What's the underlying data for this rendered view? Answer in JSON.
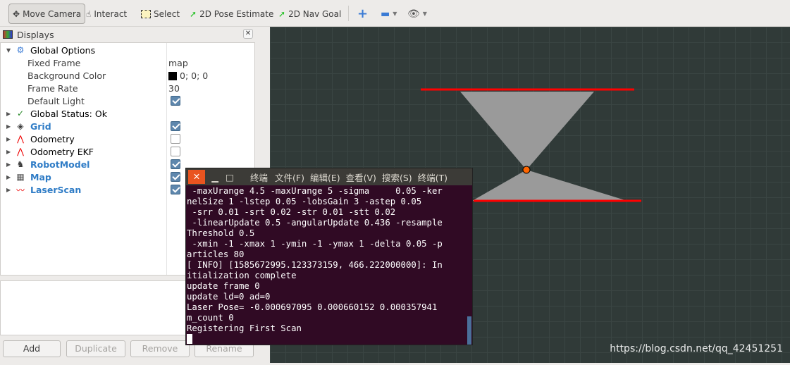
{
  "toolbar": {
    "move_camera": "Move Camera",
    "interact": "Interact",
    "select": "Select",
    "pose_estimate": "2D Pose Estimate",
    "nav_goal": "2D Nav Goal"
  },
  "displays": {
    "title": "Displays",
    "global_options": "Global Options",
    "props": [
      {
        "label": "Fixed Frame",
        "value": "map"
      },
      {
        "label": "Background Color",
        "value": "0; 0; 0"
      },
      {
        "label": "Frame Rate",
        "value": "30"
      },
      {
        "label": "Default Light",
        "checked": true
      }
    ],
    "global_status": "Global Status: Ok",
    "items": [
      {
        "label": "Grid",
        "checked": true
      },
      {
        "label": "Odometry",
        "checked": false
      },
      {
        "label": "Odometry EKF",
        "checked": false
      },
      {
        "label": "RobotModel",
        "checked": true
      },
      {
        "label": "Map",
        "checked": true
      },
      {
        "label": "LaserScan",
        "checked": true
      }
    ],
    "buttons": {
      "add": "Add",
      "duplicate": "Duplicate",
      "remove": "Remove",
      "rename": "Rename"
    }
  },
  "terminal": {
    "menu": [
      "终端",
      "文件(F)",
      "编辑(E)",
      "查看(V)",
      "搜索(S)",
      "终端(T)"
    ],
    "lines": [
      " -maxUrange 4.5 -maxUrange 5 -sigma     0.05 -ker",
      "nelSize 1 -lstep 0.05 -lobsGain 3 -astep 0.05",
      " -srr 0.01 -srt 0.02 -str 0.01 -stt 0.02",
      " -linearUpdate 0.5 -angularUpdate 0.436 -resample",
      "Threshold 0.5",
      " -xmin -1 -xmax 1 -ymin -1 -ymax 1 -delta 0.05 -p",
      "articles 80",
      "[ INFO] [1585672995.123373159, 466.222000000]: In",
      "itialization complete",
      "update frame 0",
      "update ld=0 ad=0",
      "Laser Pose= -0.000697095 0.000660152 0.000357941",
      "m_count 0",
      "Registering First Scan"
    ]
  },
  "watermark": "https://blog.csdn.net/qq_42451251",
  "colors": {
    "accent": "#2f7cc6",
    "terminal_bg": "#300a24",
    "close": "#e95420",
    "laser": "#ff0000"
  }
}
